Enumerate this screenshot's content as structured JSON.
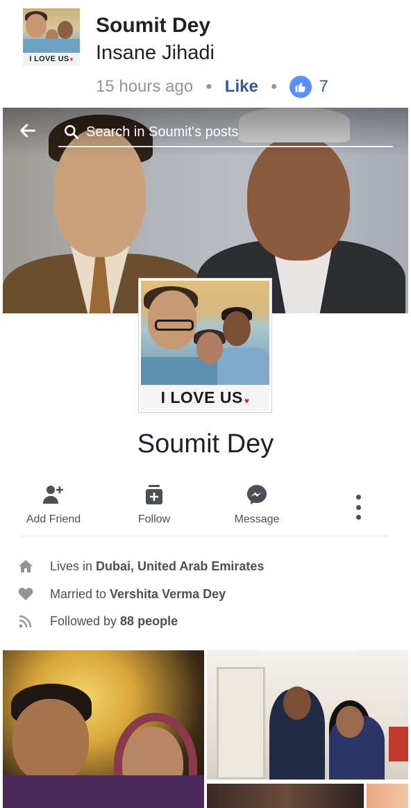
{
  "comment": {
    "author": "Soumit Dey",
    "text": "Insane Jihadi",
    "time": "15 hours ago",
    "like_label": "Like",
    "like_count": "7",
    "avatar_caption": "I LOVE US"
  },
  "header": {
    "search_placeholder": "Search in Soumit's posts"
  },
  "profile": {
    "name": "Soumit Dey",
    "picture_caption": "I LOVE US"
  },
  "actions": {
    "add_friend": "Add Friend",
    "follow": "Follow",
    "message": "Message"
  },
  "intro": {
    "lives_prefix": "Lives in",
    "lives_value": "Dubai, United Arab Emirates",
    "married_prefix": "Married to",
    "married_value": "Vershita Verma Dey",
    "followed_prefix": "Followed by",
    "followed_value": "88 people"
  },
  "colors": {
    "facebook_blue": "#365899",
    "like_blue": "#5890ff",
    "text_gray": "#4b4f56",
    "meta_gray": "#90949c"
  },
  "icons": [
    "back-arrow-icon",
    "search-icon",
    "thumbs-up-icon",
    "add-friend-icon",
    "follow-icon",
    "messenger-icon",
    "more-icon",
    "home-icon",
    "heart-icon",
    "rss-icon"
  ]
}
